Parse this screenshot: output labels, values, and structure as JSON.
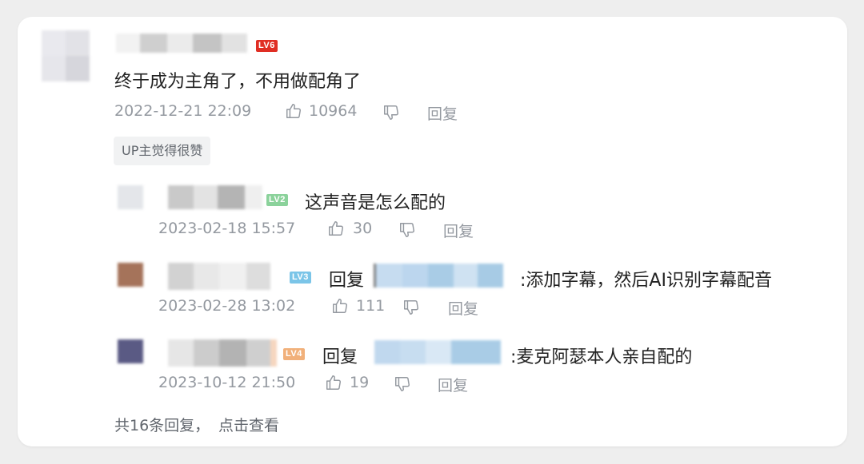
{
  "main_comment": {
    "level": "LV6",
    "text": "终于成为主角了，不用做配角了",
    "time": "2022-12-21 22:09",
    "likes": "10964",
    "reply_label": "回复",
    "badge": "UP主觉得很赞"
  },
  "replies": [
    {
      "level": "LV2",
      "text": "这声音是怎么配的",
      "time": "2023-02-18 15:57",
      "likes": "30",
      "reply_label": "回复"
    },
    {
      "level": "LV3",
      "reply_prefix": "回复",
      "text": ":添加字幕，然后AI识别字幕配音",
      "time": "2023-02-28 13:02",
      "likes": "111",
      "reply_label": "回复"
    },
    {
      "level": "LV4",
      "reply_prefix": "回复",
      "text": ":麦克阿瑟本人亲自配的",
      "time": "2023-10-12 21:50",
      "likes": "19",
      "reply_label": "回复"
    }
  ],
  "footer": {
    "more_replies": "共16条回复，",
    "view_link": "点击查看"
  },
  "colors": {
    "lv6": "#e02e24",
    "lv2": "#8bd29b",
    "lv3": "#7bc5e8",
    "lv4": "#f1b07a",
    "meta": "#9499a0"
  }
}
